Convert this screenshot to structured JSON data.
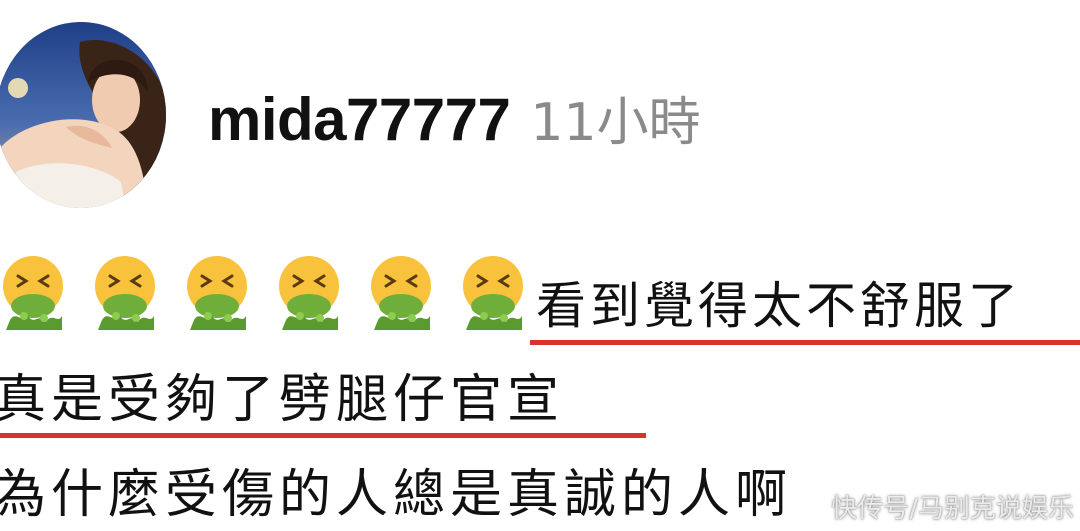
{
  "comment": {
    "username": "mida77777",
    "timestamp": "11小時",
    "emojis": [
      "nauseated-vomiting-face-emoji",
      "nauseated-vomiting-face-emoji",
      "nauseated-vomiting-face-emoji",
      "nauseated-vomiting-face-emoji",
      "nauseated-vomiting-face-emoji",
      "nauseated-vomiting-face-emoji"
    ],
    "lines": [
      "看到覺得太不舒服了",
      "真是受夠了劈腿仔官宣",
      "為什麼受傷的人總是真誠的人啊"
    ]
  },
  "watermark": "快传号/马别克说娱乐",
  "colors": {
    "underline": "#d9322b",
    "timestamp": "#8a8a8a",
    "text": "#111111"
  }
}
